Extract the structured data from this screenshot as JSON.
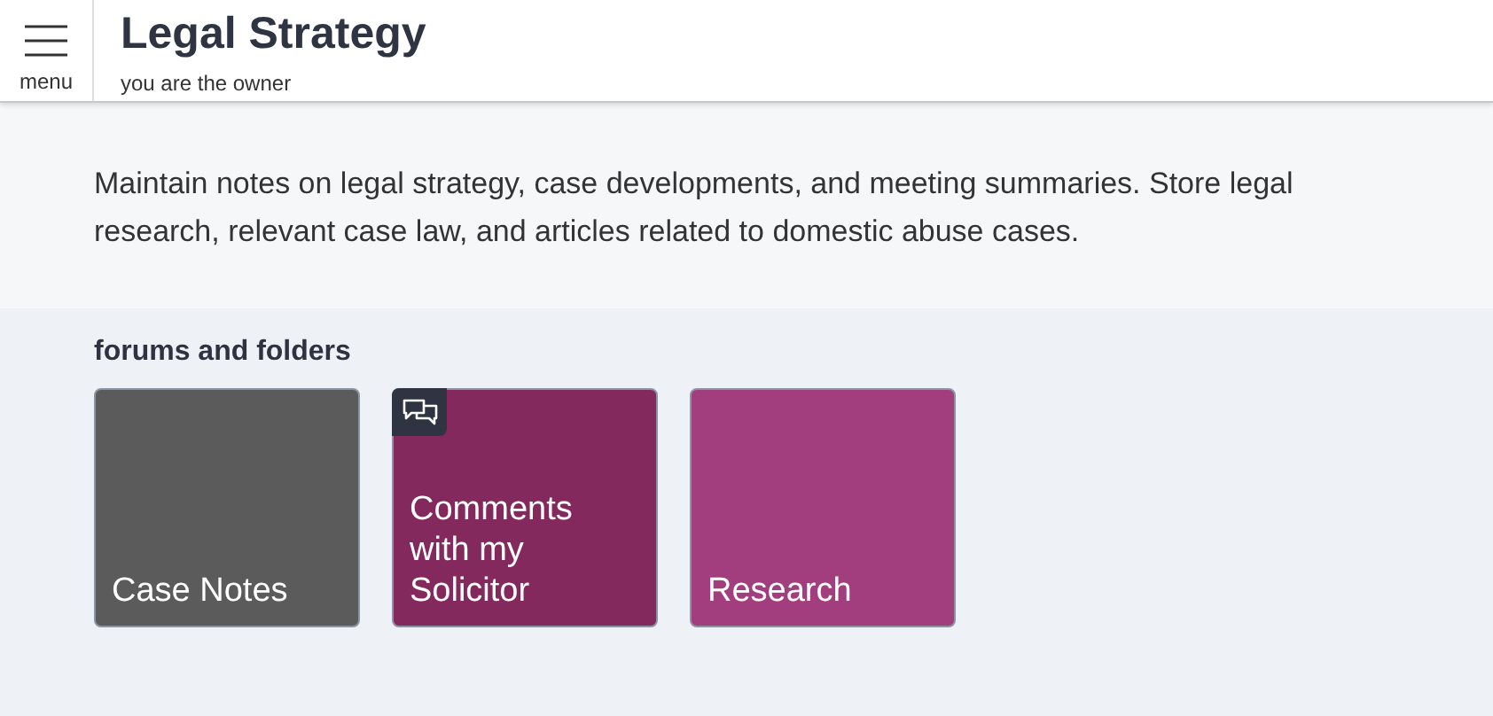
{
  "header": {
    "menu_label": "menu",
    "title": "Legal Strategy",
    "subtitle": "you are the owner"
  },
  "description": "Maintain notes on legal strategy, case developments, and meeting summaries. Store legal research, relevant case law, and articles related to domestic abuse cases.",
  "section": {
    "heading": "forums and folders",
    "tiles": [
      {
        "label": "Case Notes",
        "kind": "folder",
        "color": "#5b5b5b"
      },
      {
        "label": "Comments with my Solicitor",
        "kind": "forum",
        "color": "#84295e"
      },
      {
        "label": "Research",
        "kind": "folder",
        "color": "#a23e7e"
      }
    ]
  }
}
